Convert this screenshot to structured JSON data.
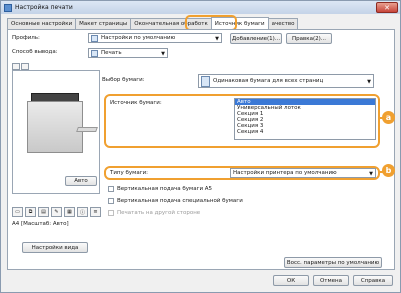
{
  "window": {
    "title": "Настройка печати",
    "close_glyph": "✕"
  },
  "tabs": [
    {
      "label": "Основные настройки",
      "active": false
    },
    {
      "label": "Макет страницы",
      "active": false
    },
    {
      "label": "Окончательная обработк",
      "active": false
    },
    {
      "label": "Источник бумаги",
      "active": true
    },
    {
      "label": "ачество",
      "active": false
    }
  ],
  "profile": {
    "label": "Профиль:",
    "value": "Настройки по умолчанию",
    "add_button": "Добавление(1)...",
    "edit_button": "Правка(2)..."
  },
  "output": {
    "label": "Способ вывода:",
    "value": "Печать"
  },
  "paper_select": {
    "label": "Выбор бумаги:",
    "value": "Одинаковая бумага для всех страниц"
  },
  "paper_source": {
    "label": "Источник бумаги:",
    "options": [
      "Авто",
      "Универсальный лоток",
      "Секция 1",
      "Секция 2",
      "Секция 3",
      "Секция 4"
    ],
    "selected_index": 0
  },
  "paper_type": {
    "label": "Типу бумаги:",
    "value": "Настройки принтера по умолчанию"
  },
  "checkboxes": [
    {
      "label": "Вертикальная подача бумаги A5",
      "checked": false,
      "enabled": true
    },
    {
      "label": "Вертикальная подача специальной бумаги",
      "checked": false,
      "enabled": true
    },
    {
      "label": "Печатать на другой стороне",
      "checked": false,
      "enabled": false
    }
  ],
  "preview": {
    "auto_button": "Авто",
    "status": "A4 [Масштаб: Авто]",
    "view_settings_button": "Настройки вида"
  },
  "restore_button": "Восс. параметры по умолчанию",
  "footer": {
    "ok": "ОК",
    "cancel": "Отмена",
    "help": "Справка"
  },
  "callouts": {
    "a": "a",
    "b": "b"
  },
  "colors": {
    "highlight": "#f0a030",
    "selection": "#3b79d6"
  },
  "icons": [
    "printer-icon",
    "document-icon",
    "layout-icon",
    "info-icon",
    "settings-icon",
    "tray-icon",
    "page-icon"
  ]
}
